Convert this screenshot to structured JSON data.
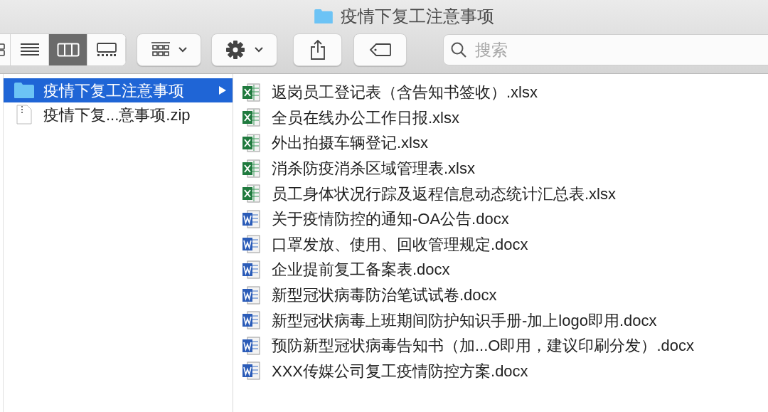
{
  "window": {
    "title": "疫情下复工注意事项"
  },
  "toolbar": {
    "view_buttons": [
      {
        "kind": "icons",
        "selected": false
      },
      {
        "kind": "list",
        "selected": false
      },
      {
        "kind": "columns",
        "selected": true
      },
      {
        "kind": "gallery",
        "selected": false
      }
    ]
  },
  "search": {
    "placeholder": "搜索"
  },
  "column_1": [
    {
      "name": "疫情下复工注意事项",
      "kind": "folder",
      "selected": true
    },
    {
      "name": "疫情下复...意事项.zip",
      "kind": "zip",
      "selected": false
    }
  ],
  "column_2": [
    {
      "name": "返岗员工登记表（含告知书签收）.xlsx",
      "kind": "xlsx"
    },
    {
      "name": "全员在线办公工作日报.xlsx",
      "kind": "xlsx"
    },
    {
      "name": "外出拍摄车辆登记.xlsx",
      "kind": "xlsx"
    },
    {
      "name": "消杀防疫消杀区域管理表.xlsx",
      "kind": "xlsx"
    },
    {
      "name": "员工身体状况行踪及返程信息动态统计汇总表.xlsx",
      "kind": "xlsx"
    },
    {
      "name": "关于疫情防控的通知-OA公告.docx",
      "kind": "docx"
    },
    {
      "name": "口罩发放、使用、回收管理规定.docx",
      "kind": "docx"
    },
    {
      "name": "企业提前复工备案表.docx",
      "kind": "docx"
    },
    {
      "name": "新型冠状病毒防治笔试试卷.docx",
      "kind": "docx"
    },
    {
      "name": "新型冠状病毒上班期间防护知识手册-加上logo即用.docx",
      "kind": "docx"
    },
    {
      "name": "预防新型冠状病毒告知书（加...O即用，建议印刷分发）.docx",
      "kind": "docx"
    },
    {
      "name": "XXX传媒公司复工疫情防控方案.docx",
      "kind": "docx"
    }
  ]
}
